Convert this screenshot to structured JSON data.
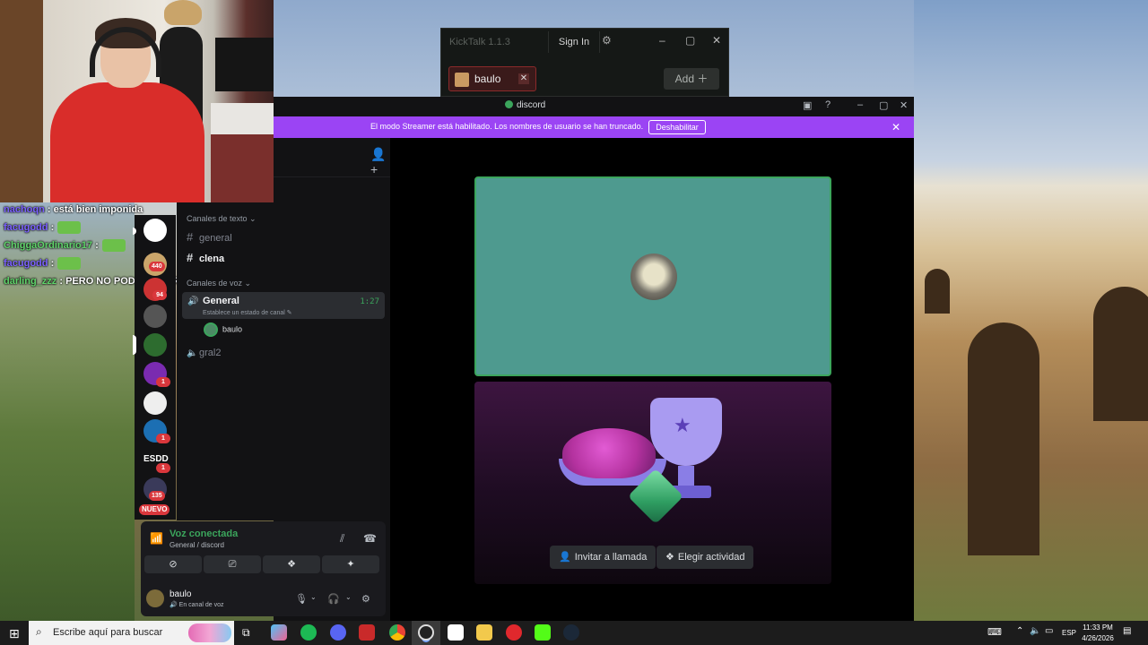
{
  "kicktalk": {
    "title": "KickTalk 1.1.3",
    "signin": "Sign In",
    "gear_icon": "gear-icon",
    "controls": [
      "–",
      "▢",
      "✕"
    ],
    "tab_name": "baulo",
    "add": "Add ＋"
  },
  "chat": [
    {
      "user": "nachoqn",
      "text": ": está bien imponida",
      "color": "#7b61ff"
    },
    {
      "user": "facugodd",
      "text": ":",
      "color": "#7b61ff"
    },
    {
      "user": "ChiggaOrdinario17",
      "text": ":",
      "color": "#5fd36a"
    },
    {
      "user": "facugodd",
      "text": ":",
      "color": "#7b61ff"
    },
    {
      "user": "darling_zzz",
      "text": ": PERO NO PODES USAR AURIS",
      "color": "#5fd36a"
    }
  ],
  "discord": {
    "title": "discord",
    "banner": {
      "text": "El modo Streamer está habilitado. Los nombres de usuario se han truncado.",
      "button": "Deshabilitar",
      "close": "✕"
    },
    "rail": {
      "server_text_esdd": "ESDD",
      "badges": [
        "440",
        "94",
        "1",
        "1",
        "1",
        "135",
        "NUEVO"
      ]
    },
    "channels": {
      "text_category": "Canales de texto ⌄",
      "text_channels": [
        "general",
        "clena"
      ],
      "voice_category": "Canales de voz ⌄",
      "voice_active": {
        "name": "General",
        "status": "Establece un estado de canal ✎",
        "time": "1:27",
        "user": "baulo"
      },
      "voice_other": "gral2"
    },
    "voice_panel": {
      "title": "Voz conectada",
      "subtitle": "General / discord",
      "username": "baulo",
      "user_status": "🔊 En canal de voz"
    },
    "stage": {
      "invite": "Invitar a llamada",
      "activity": "Elegir actividad"
    }
  },
  "taskbar": {
    "search_placeholder": "Escribe aquí para buscar",
    "lang": "ESP",
    "time": "11:33 PM",
    "date": "4/26/2026"
  },
  "colors": {
    "discord_accent": "#9b44f4",
    "voice_green": "#3ba55c",
    "badge_red": "#da373c"
  }
}
